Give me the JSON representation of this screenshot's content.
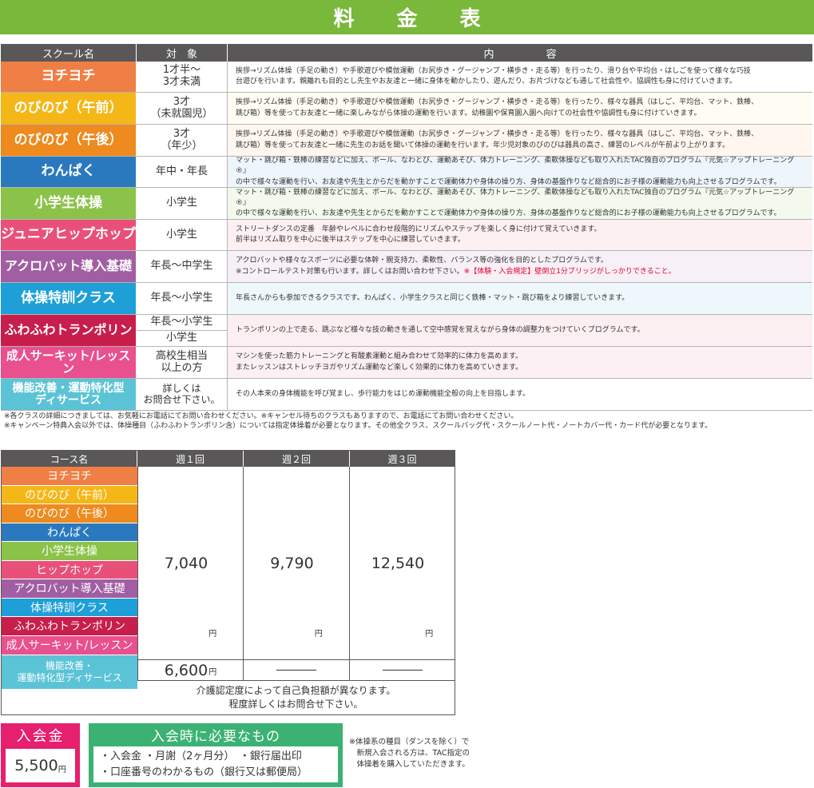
{
  "title": "料 金 表",
  "colors": {
    "title_green": "#79b83a",
    "header_gray": "#595757",
    "hiyoko": "#ef7f45",
    "nobi_am": "#f5b717",
    "nobi_pm": "#ee8a1e",
    "wanpaku": "#2a79be",
    "shogakusei": "#8bc34a",
    "hiphop": "#e8507a",
    "acro": "#a15ea2",
    "tokkun": "#1e9fd7",
    "tramp": "#c81e4c",
    "adult": "#e8508e",
    "kino": "#5bc3d6",
    "fee_pink": "#e61f6e",
    "need_green": "#3bb273",
    "warn_red": "#e4002b"
  },
  "table1": {
    "headers": {
      "name": "スクール名",
      "target": "対　象",
      "content": "内　　　　　容"
    },
    "rows": [
      {
        "name": "ヨチヨチ",
        "target": [
          "1才半〜",
          "3才未満"
        ],
        "lines": [
          "挨拶→リズム体操（手足の動き）や手歌遊びや模倣運動（お尻歩き・グージャンプ・横歩き・走る等）を行ったり、滑り台や平均台・はしごを使って様々な巧技",
          "台遊びを行います。親離れも目的とし先生やお友達と一緒に身体を動かしたり、遊んだり、お片づけなども通して社会性や、協調性も身に付けていきます。"
        ]
      },
      {
        "name": "のびのび（午前）",
        "target": [
          "3才",
          "（未就園児）"
        ],
        "lines": [
          "挨拶→リズム体操（手足の動き）や手歌遊びや模倣運動（お尻歩き・グージャンプ・横歩き・走る等）を行ったり、様々な器具（はしご、平均台、マット、鉄棒、",
          "跳び箱）等を使ってお友達と一緒に楽しみながら体操の運動を行います。幼稚園や保育園入園へ向けての社会性や協調性も身に付けていきます。"
        ]
      },
      {
        "name": "のびのび（午後）",
        "target": [
          "3才",
          "（年少）"
        ],
        "lines": [
          "挨拶→リズム体操（手足の動き）や手歌遊びや模倣運動（お尻歩き・グージャンプ・横歩き・走る等）を行ったり、様々な器具（はしご、平均台、マット、鉄棒、",
          "跳び箱）等を使ってお友達と一緒に先生のお話を聞いて体操の運動を行います。年少児対象のびのびは器具の高さ、練習のレベルが午前より上がります。"
        ]
      },
      {
        "name": "わんぱく",
        "target": [
          "年中・年長"
        ],
        "lines": [
          "マット・跳び箱・鉄棒の練習などに加え、ボール、なわとび、運動あそび、体力トレーニング、柔軟体操なども取り入れたTAC独自のプログラム『元気☆アップトレーニング®』",
          "の中で様々な運動を行い、お友達や先生とからだを動かすことで運動体力や身体の操り方、身体の基盤作りなど総合的にお子様の運動能力も向上させるプログラムです。"
        ]
      },
      {
        "name": "小学生体操",
        "target": [
          "小学生"
        ],
        "lines": [
          "マット・跳び箱・鉄棒の練習などに加え、ボール、なわとび、運動あそび、体力トレーニング、柔軟体操なども取り入れたTAC独自のプログラム『元気☆アップトレーニング®』",
          "の中で様々な運動を行い、お友達や先生とからだを動かすことで運動体力や身体の操り方、身体の基盤作りなど総合的にお子様の運動能力も向上させるプログラムです。"
        ]
      },
      {
        "name": "ジュニアヒップホップ",
        "target": [
          "小学生"
        ],
        "lines": [
          "ストリートダンスの定番　年齢やレベルに合わせ段階的にリズムやステップを楽しく身に付けて覚えていきます。",
          "前半はリズム取りを中心に後半はステップを中心に練習していきます。"
        ]
      },
      {
        "name": "アクロバット導入基礎",
        "target": [
          "年長〜中学生"
        ],
        "lines": [
          "アクロバットや様々なスポーツに必要な体幹・腕支持力、柔軟性、バランス等の強化を目的としたプログラムです。",
          "※コントロールテスト対策も行います。詳しくはお問い合わせ下さい。"
        ],
        "warn": "※【体験・入会規定】壁倒立1分ブリッジがしっかりできること。"
      },
      {
        "name": "体操特訓クラス",
        "target": [
          "年長〜小学生"
        ],
        "lines": [
          "年長さんからも参加できるクラスです。わんぱく、小学生クラスと同じく鉄棒・マット・跳び箱をより練習していきます。"
        ]
      },
      {
        "name": "ふわふわトランポリン",
        "target": [
          "年長〜小学生",
          "小学生"
        ],
        "lines": [
          "トランポリンの上で走る、跳ぶなど様々な技の動きを通して空中感覚を覚えながら身体の調整力をつけていくプログラムです。"
        ]
      },
      {
        "name": "成人サーキット/レッスン",
        "target": [
          "高校生相当",
          "以上の方"
        ],
        "lines": [
          "マシンを使った筋力トレーニングと有酸素運動と組み合わせて効率的に体力を高めます。",
          "またレッスンはストレッチヨガやリズム運動など楽しく効果的に体力を高めていきます。"
        ]
      },
      {
        "name": [
          "機能改善・運動特化型",
          "ディサービス"
        ],
        "target": [
          "詳しくは",
          "お問合せ下さい。"
        ],
        "lines": [
          "その人本来の身体機能を呼び覚まし、歩行能力をはじめ運動機能全般の向上を目指します。"
        ]
      }
    ],
    "notes": [
      "※各クラスの詳細につきましては、お気軽にお電話にてお問い合わせください。※キャンセル待ちのクラスもありますので、お電話にてお問い合わせください。",
      "※キャンペーン特典入会以外では、体操種目（ふわふわトランポリン含）については指定体操着が必要となります。その他全クラス、スクールバッグ代・スクールノート代・ノートカバー代・カード代が必要となります。"
    ]
  },
  "table2": {
    "headers": {
      "name": "コース名",
      "w1": "週１回",
      "w2": "週２回",
      "w3": "週３回"
    },
    "courses": [
      "ヨチヨチ",
      "のびのび（午前）",
      "のびのび（午後）",
      "わんぱく",
      "小学生体操",
      "ヒップホップ",
      "アクロバット導入基礎",
      "体操特訓クラス",
      "ふわふわトランポリン"
    ],
    "price_w1": "7,040",
    "price_w2": "9,790",
    "price_w3": "12,540",
    "yen": "円",
    "adult_name": "成人サーキット/レッスン",
    "adult_price": "6,600",
    "care_name": [
      "機能改善・",
      "運動特化型ディサービス"
    ],
    "care_note": [
      "介護認定度によって自己負担額が異なります。",
      "程度詳しくはお問合せ下さい。"
    ]
  },
  "fee": {
    "label": "入会金",
    "value": "5,500",
    "yen": "円"
  },
  "required": {
    "label": "入会時に必要なもの",
    "lines": [
      "・入会金 ・月謝（2ヶ月分）　・銀行届出印",
      "・口座番号のわかるもの（銀行又は郵便局）"
    ]
  },
  "side_note": [
    "※体操系の種目（ダンスを除く）で",
    "　新規入会される方は、TAC指定の",
    "　体操着を購入していただきます。"
  ]
}
